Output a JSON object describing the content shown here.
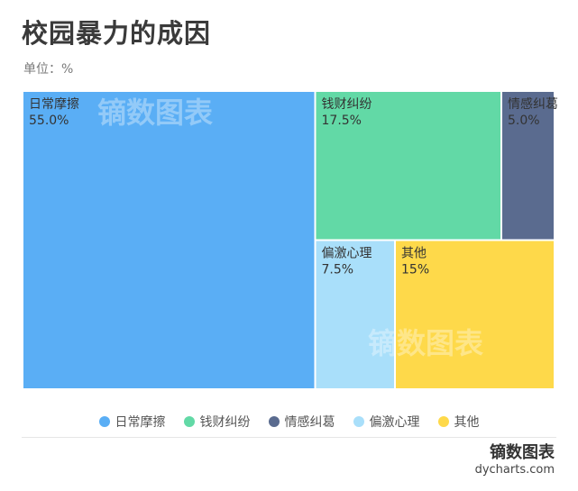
{
  "title": "校园暴力的成因",
  "unit_label": "单位：%",
  "chart_data": {
    "type": "treemap",
    "title": "校园暴力的成因",
    "unit": "%",
    "items": [
      {
        "name": "日常摩擦",
        "value": 55.0,
        "label": "55.0%",
        "color": "#5aaef5"
      },
      {
        "name": "钱财纠纷",
        "value": 17.5,
        "label": "17.5%",
        "color": "#62d9a6"
      },
      {
        "name": "情感纠葛",
        "value": 5.0,
        "label": "5.0%",
        "color": "#5a6b8f"
      },
      {
        "name": "偏激心理",
        "value": 7.5,
        "label": "7.5%",
        "color": "#a9dffa"
      },
      {
        "name": "其他",
        "value": 15,
        "label": "15%",
        "color": "#fed94a"
      }
    ],
    "legend_position": "bottom"
  },
  "legend": [
    {
      "label": "日常摩擦",
      "color": "#5aaef5"
    },
    {
      "label": "钱财纠纷",
      "color": "#62d9a6"
    },
    {
      "label": "情感纠葛",
      "color": "#5a6b8f"
    },
    {
      "label": "偏激心理",
      "color": "#a9dffa"
    },
    {
      "label": "其他",
      "color": "#fed94a"
    }
  ],
  "watermark_text": "镝数图表",
  "brand": {
    "name": "镝数图表",
    "url": "dycharts.com"
  }
}
